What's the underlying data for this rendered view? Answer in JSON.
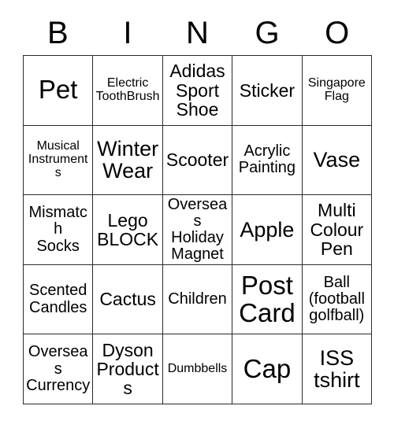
{
  "card": {
    "title": "BINGO",
    "header_letters": [
      "B",
      "I",
      "N",
      "G",
      "O"
    ],
    "columns": 5,
    "rows": 5,
    "colors": {
      "background": "#ffffff",
      "text": "#000000",
      "grid_line": "#2a2a2a"
    },
    "cells": [
      [
        {
          "text": "Pet",
          "size": "fs-xxl"
        },
        {
          "text": "Electric\nToothBrush",
          "size": "fs-sm"
        },
        {
          "text": "Adidas\nSport\nShoe",
          "size": "fs-lg"
        },
        {
          "text": "Sticker",
          "size": "fs-lg"
        },
        {
          "text": "Singapore\nFlag",
          "size": "fs-sm"
        }
      ],
      [
        {
          "text": "Musical\nInstruments",
          "size": "fs-sm"
        },
        {
          "text": "Winter\nWear",
          "size": "fs-xl"
        },
        {
          "text": "Scooter",
          "size": "fs-lg"
        },
        {
          "text": "Acrylic\nPainting",
          "size": "fs-md"
        },
        {
          "text": "Vase",
          "size": "fs-xl"
        }
      ],
      [
        {
          "text": "Mismatch\nSocks",
          "size": "fs-md"
        },
        {
          "text": "Lego\nBLOCK",
          "size": "fs-lg"
        },
        {
          "text": "Overseas\nHoliday\nMagnet",
          "size": "fs-md"
        },
        {
          "text": "Apple",
          "size": "fs-xl"
        },
        {
          "text": "Multi\nColour\nPen",
          "size": "fs-lg"
        }
      ],
      [
        {
          "text": "Scented\nCandles",
          "size": "fs-md"
        },
        {
          "text": "Cactus",
          "size": "fs-lg"
        },
        {
          "text": "Children",
          "size": "fs-md"
        },
        {
          "text": "Post\nCard",
          "size": "fs-xxl"
        },
        {
          "text": "Ball\n(football\ngolfball)",
          "size": "fs-md"
        }
      ],
      [
        {
          "text": "Overseas\nCurrency",
          "size": "fs-md"
        },
        {
          "text": "Dyson\nProducts",
          "size": "fs-lg"
        },
        {
          "text": "Dumbbells",
          "size": "fs-sm"
        },
        {
          "text": "Cap",
          "size": "fs-xxl"
        },
        {
          "text": "ISS\ntshirt",
          "size": "fs-xl"
        }
      ]
    ]
  }
}
